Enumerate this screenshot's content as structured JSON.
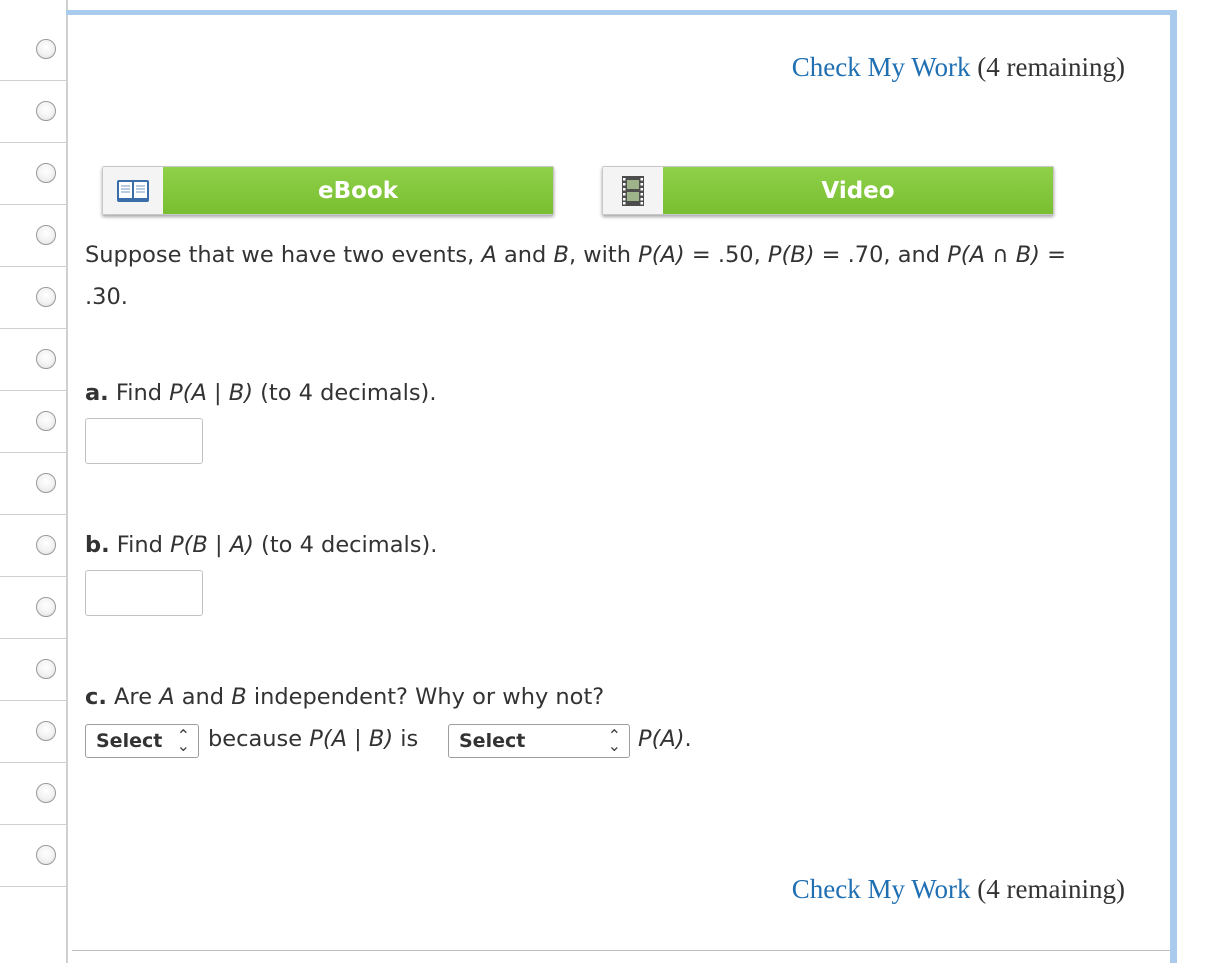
{
  "radio_count": 14,
  "header": {
    "check_my_work": "Check My Work",
    "remaining": "(4 remaining)"
  },
  "resources": {
    "ebook_label": "eBook",
    "video_label": "Video",
    "ebook_icon": "book-icon",
    "video_icon": "film-icon"
  },
  "question": {
    "intro_1": "Suppose that we have two events, ",
    "event_a": "A",
    "and": " and ",
    "event_b": "B",
    "with": ", with ",
    "pa": "P(A)",
    "pa_val": " = .50, ",
    "pb": "P(B)",
    "pb_val": " = .70, and ",
    "pab": "P(A ∩ B)",
    "eq": " =",
    "line2": ".30."
  },
  "part_a": {
    "label": "a.",
    "find": " Find ",
    "expr": "P(A | B)",
    "suffix": " (to 4 decimals).",
    "value": ""
  },
  "part_b": {
    "label": "b.",
    "find": " Find ",
    "expr": "P(B | A)",
    "suffix": " (to 4 decimals).",
    "value": ""
  },
  "part_c": {
    "label": "c.",
    "q1": " Are ",
    "a": "A",
    "and": " and ",
    "b": "B",
    "q2": " independent? Why or why not?",
    "select1": "Select",
    "because": " because ",
    "expr": "P(A | B)",
    "is": " is ",
    "select2": "Select",
    "pa": "P(A)",
    "period": "."
  },
  "footer": {
    "check_my_work": "Check My Work",
    "remaining": "(4 remaining)"
  }
}
